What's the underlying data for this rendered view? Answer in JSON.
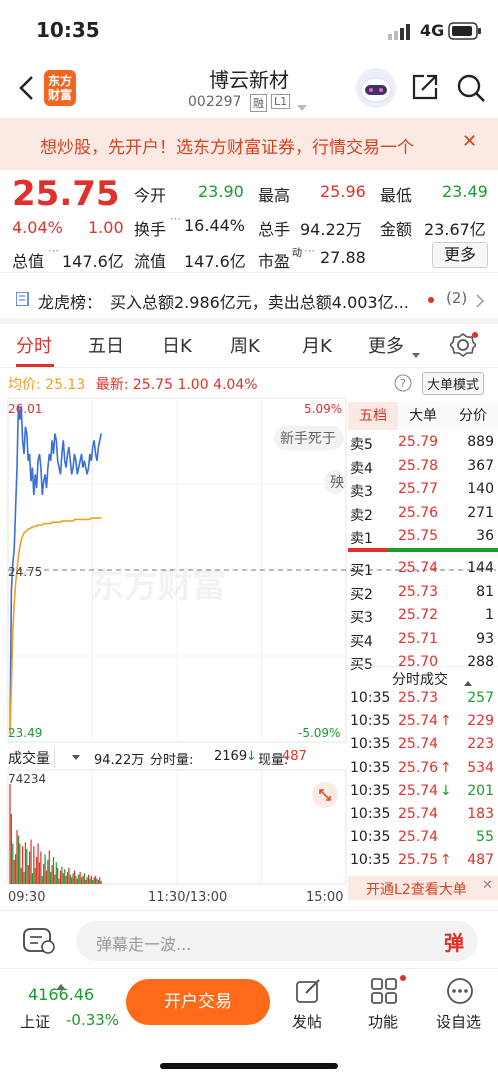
{
  "status": {
    "time": "10:35",
    "network": "4G"
  },
  "nav": {
    "title": "博云新材",
    "code": "002297",
    "badge1": "融",
    "badge2": "L1",
    "logo": "东方\n财富"
  },
  "banner": {
    "text": "想炒股，先开户！选东方财富证券，行情交易一个",
    "close": "✕"
  },
  "quote": {
    "price": "25.75",
    "pct": "4.04%",
    "chg": "1.00",
    "open_label": "今开",
    "open": "23.90",
    "high_label": "最高",
    "high": "25.96",
    "low_label": "最低",
    "low": "23.49",
    "turn_label": "换手",
    "turn": "16.44%",
    "vol_label": "总手",
    "vol": "94.22万",
    "amt_label": "金额",
    "amt": "23.67亿",
    "mcap_label": "总值",
    "mcap": "147.6亿",
    "float_label": "流值",
    "float": "147.6亿",
    "pe_label": "市盈",
    "pe_sup": "动",
    "pe": "27.88",
    "more": "更多"
  },
  "lhb": {
    "label": "龙虎榜：",
    "text": "买入总额2.986亿元，卖出总额4.003亿...",
    "count": "(2)"
  },
  "tabs": [
    "分时",
    "五日",
    "日K",
    "周K",
    "月K",
    "更多"
  ],
  "chart_info": {
    "avg_label": "均价:",
    "avg": "25.13",
    "latest_label": "最新:",
    "latest": "25.75",
    "chg": "1.00",
    "pct": "4.04%",
    "big_order": "大单模式"
  },
  "chart_labels": {
    "ymax": "26.01",
    "ymid": "24.75",
    "ymin": "23.49",
    "pmax": "5.09%",
    "pmin": "-5.09%",
    "bubble": "新手死于",
    "bubble2": "殃",
    "watermark": "东方财富"
  },
  "orderbook": {
    "tabs": [
      "五档",
      "大单",
      "分价"
    ],
    "asks": [
      {
        "l": "卖5",
        "p": "25.79",
        "v": "889"
      },
      {
        "l": "卖4",
        "p": "25.78",
        "v": "367"
      },
      {
        "l": "卖3",
        "p": "25.77",
        "v": "140"
      },
      {
        "l": "卖2",
        "p": "25.76",
        "v": "271"
      },
      {
        "l": "卖1",
        "p": "25.75",
        "v": "36"
      }
    ],
    "bids": [
      {
        "l": "买1",
        "p": "25.74",
        "v": "144"
      },
      {
        "l": "买2",
        "p": "25.73",
        "v": "81"
      },
      {
        "l": "买3",
        "p": "25.72",
        "v": "1"
      },
      {
        "l": "买4",
        "p": "25.71",
        "v": "93"
      },
      {
        "l": "买5",
        "p": "25.70",
        "v": "288"
      }
    ]
  },
  "ticks": {
    "title": "分时成交",
    "rows": [
      {
        "t": "10:35",
        "p": "25.73",
        "a": "",
        "v": "257",
        "vc": "green"
      },
      {
        "t": "10:35",
        "p": "25.74",
        "a": "↑",
        "v": "229",
        "vc": "red"
      },
      {
        "t": "10:35",
        "p": "25.74",
        "a": "",
        "v": "223",
        "vc": "red"
      },
      {
        "t": "10:35",
        "p": "25.76",
        "a": "↑",
        "v": "534",
        "vc": "red"
      },
      {
        "t": "10:35",
        "p": "25.74",
        "a": "↓",
        "v": "201",
        "vc": "green"
      },
      {
        "t": "10:35",
        "p": "25.74",
        "a": "",
        "v": "183",
        "vc": "red"
      },
      {
        "t": "10:35",
        "p": "25.74",
        "a": "",
        "v": "55",
        "vc": "green"
      },
      {
        "t": "10:35",
        "p": "25.75",
        "a": "↑",
        "v": "487",
        "vc": "red"
      }
    ]
  },
  "l2": {
    "text": "开通L2查看大单",
    "close": "✕"
  },
  "volume": {
    "label": "成交量",
    "total": "94.22万",
    "fs_label": "分时量:",
    "fs": "2169",
    "arrow": "↓",
    "now_label": "现量:",
    "now": "487",
    "max": "74234"
  },
  "axis": {
    "start": "09:30",
    "mid": "11:30/13:00",
    "end": "15:00"
  },
  "danmu": {
    "placeholder": "弹幕走一波...",
    "btn": "弹"
  },
  "bottom": {
    "index": "4166.46",
    "index_name": "上证",
    "index_pct": "-0.33%",
    "trade": "开户交易",
    "post": "发帖",
    "func": "功能",
    "settings": "设自选"
  },
  "chart_data": {
    "type": "line",
    "x": [
      "09:30",
      "09:31",
      "09:32",
      "09:33",
      "09:34",
      "09:35",
      "09:36",
      "09:37",
      "09:38",
      "09:39",
      "09:40",
      "09:41",
      "09:42",
      "09:43",
      "09:44",
      "09:45",
      "09:46",
      "09:47",
      "09:48",
      "09:49",
      "09:50",
      "09:51",
      "09:52",
      "09:53",
      "09:54",
      "09:55",
      "09:56",
      "09:57",
      "09:58",
      "09:59",
      "10:00",
      "10:01",
      "10:02",
      "10:03",
      "10:04",
      "10:05",
      "10:06",
      "10:07",
      "10:08",
      "10:09",
      "10:10",
      "10:11",
      "10:12",
      "10:13",
      "10:14",
      "10:15",
      "10:16",
      "10:17",
      "10:18",
      "10:19",
      "10:20",
      "10:21",
      "10:22",
      "10:23",
      "10:24",
      "10:25",
      "10:26",
      "10:27",
      "10:28",
      "10:29",
      "10:30",
      "10:31",
      "10:32",
      "10:33",
      "10:34",
      "10:35"
    ],
    "series": [
      {
        "values": [
          23.55,
          24.6,
          24.8,
          24.9,
          25.2,
          25.5,
          25.96,
          25.85,
          25.95,
          25.7,
          25.6,
          25.8,
          25.75,
          25.55,
          25.6,
          25.4,
          25.5,
          25.3,
          25.45,
          25.35,
          25.55,
          25.6,
          25.5,
          25.3,
          25.4,
          25.45,
          25.35,
          25.5,
          25.6,
          25.55,
          25.7,
          25.6,
          25.75,
          25.7,
          25.55,
          25.5,
          25.45,
          25.6,
          25.7,
          25.55,
          25.5,
          25.6,
          25.65,
          25.55,
          25.45,
          25.5,
          25.6,
          25.55,
          25.45,
          25.5,
          25.55,
          25.6,
          25.5,
          25.55,
          25.5,
          25.45,
          25.5,
          25.6,
          25.55,
          25.65,
          25.7,
          25.6,
          25.55,
          25.65,
          25.7,
          25.75
        ]
      },
      {
        "values": [
          23.55,
          23.9,
          24.3,
          24.5,
          24.65,
          24.75,
          24.85,
          24.92,
          24.97,
          25.0,
          25.02,
          25.03,
          25.04,
          25.05,
          25.05,
          25.06,
          25.06,
          25.07,
          25.07,
          25.07,
          25.08,
          25.08,
          25.08,
          25.08,
          25.09,
          25.09,
          25.09,
          25.09,
          25.09,
          25.09,
          25.1,
          25.1,
          25.1,
          25.1,
          25.1,
          25.1,
          25.1,
          25.11,
          25.11,
          25.11,
          25.11,
          25.11,
          25.11,
          25.11,
          25.11,
          25.11,
          25.12,
          25.12,
          25.12,
          25.12,
          25.12,
          25.12,
          25.12,
          25.12,
          25.12,
          25.12,
          25.12,
          25.12,
          25.13,
          25.13,
          25.13,
          25.13,
          25.13,
          25.13,
          25.13,
          25.13
        ]
      }
    ],
    "volume": [
      74234,
      52000,
      30000,
      18000,
      22000,
      40000,
      36000,
      30000,
      12000,
      28000,
      9000,
      31000,
      26000,
      14000,
      24000,
      33000,
      8000,
      28000,
      12000,
      20000,
      30000,
      16000,
      24000,
      6000,
      15000,
      22000,
      10000,
      18000,
      25000,
      9000,
      14000,
      20000,
      7000,
      16000,
      12000,
      4000,
      10000,
      13000,
      8000,
      11000,
      6000,
      9000,
      12000,
      7000,
      5000,
      8000,
      10000,
      6000,
      4000,
      7000,
      9000,
      5000,
      6000,
      8000,
      3000,
      5000,
      7000,
      4000,
      6000,
      3000,
      5000,
      6000,
      4000,
      3000,
      5000,
      2169
    ],
    "volume_colors": [
      "red",
      "red",
      "green",
      "red",
      "green",
      "red",
      "green",
      "red",
      "green",
      "red",
      "green",
      "red",
      "green",
      "red",
      "green",
      "red",
      "green",
      "red",
      "green",
      "red",
      "red",
      "green",
      "red",
      "green",
      "red",
      "green",
      "red",
      "green",
      "red",
      "green",
      "red",
      "green",
      "red",
      "green",
      "red",
      "green",
      "red",
      "green",
      "red",
      "green",
      "red",
      "green",
      "red",
      "green",
      "red",
      "green",
      "red",
      "green",
      "red",
      "green",
      "red",
      "green",
      "red",
      "green",
      "red",
      "green",
      "red",
      "green",
      "red",
      "green",
      "red",
      "green",
      "red",
      "green",
      "red",
      "red"
    ],
    "ylim": [
      23.49,
      26.01
    ],
    "prev_close": 24.75
  },
  "colors": {
    "up": "#e0302a",
    "down": "#1a9b2c",
    "avg": "#f0a020",
    "accent": "#ff6a1a"
  }
}
